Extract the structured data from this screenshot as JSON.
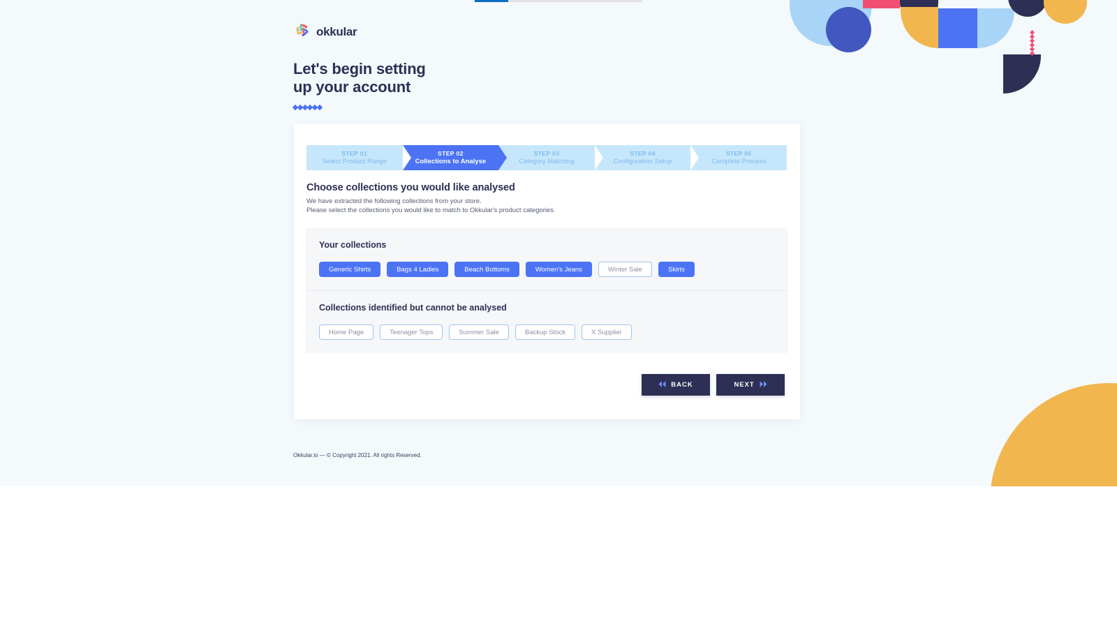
{
  "brand": {
    "name": "okkular",
    "logo_icon": "okkular-pinwheel-logo"
  },
  "header": {
    "headline_line1": "Let's begin setting",
    "headline_line2": "up your account",
    "dots_count": 6
  },
  "loading_bar": {
    "progress_percent": 20
  },
  "stepper": {
    "steps": [
      {
        "number": "STEP 01",
        "label": "Select Product Range",
        "active": false
      },
      {
        "number": "STEP 02",
        "label": "Collections to Analyse",
        "active": true
      },
      {
        "number": "STEP 03",
        "label": "Category Matching",
        "active": false
      },
      {
        "number": "STEP 04",
        "label": "Configuration Setup",
        "active": false
      },
      {
        "number": "STEP 05",
        "label": "Complete Process",
        "active": false
      }
    ]
  },
  "intro": {
    "title": "Choose collections you would like analysed",
    "line1": "We have extracted the following collections from your store.",
    "line2": "Please select the collections you would like to match to Okkular's product categories."
  },
  "your_collections": {
    "title": "Your collections",
    "tags": [
      {
        "label": "Generic Shirts",
        "selected": true
      },
      {
        "label": "Bags 4 Ladies",
        "selected": true
      },
      {
        "label": "Beach Bottoms",
        "selected": true
      },
      {
        "label": "Women's Jeans",
        "selected": true
      },
      {
        "label": "Winter Sale",
        "selected": false
      },
      {
        "label": "Skirts",
        "selected": true
      }
    ]
  },
  "unavailable_collections": {
    "title": "Collections identified but cannot be analysed",
    "tags": [
      {
        "label": "Home Page"
      },
      {
        "label": "Teenager Tops"
      },
      {
        "label": "Summer Sale"
      },
      {
        "label": "Backup Stock"
      },
      {
        "label": "X Supplier"
      }
    ]
  },
  "actions": {
    "back_label": "BACK",
    "next_label": "NEXT",
    "back_icon": "double-chevron-left-icon",
    "next_icon": "double-chevron-right-icon"
  },
  "footer": {
    "text": "Okkular.io — © Copyright 2021. All rights Reserved."
  },
  "colors": {
    "page_background": "#f4f9fc",
    "card_background": "#ffffff",
    "accent_blue": "#4b73f4",
    "step_inactive": "#c6e7fb",
    "step_inactive_text": "#7fb9f0",
    "navy": "#2e2f54",
    "panel_background": "#f6f7f9",
    "orange": "#f2b64e",
    "pink": "#f14f72",
    "light_blue": "#a8d5f7",
    "deep_blue": "#4258c0",
    "loadbar_fill": "#0b6fc4",
    "loadbar_track": "#e2e2e2"
  }
}
